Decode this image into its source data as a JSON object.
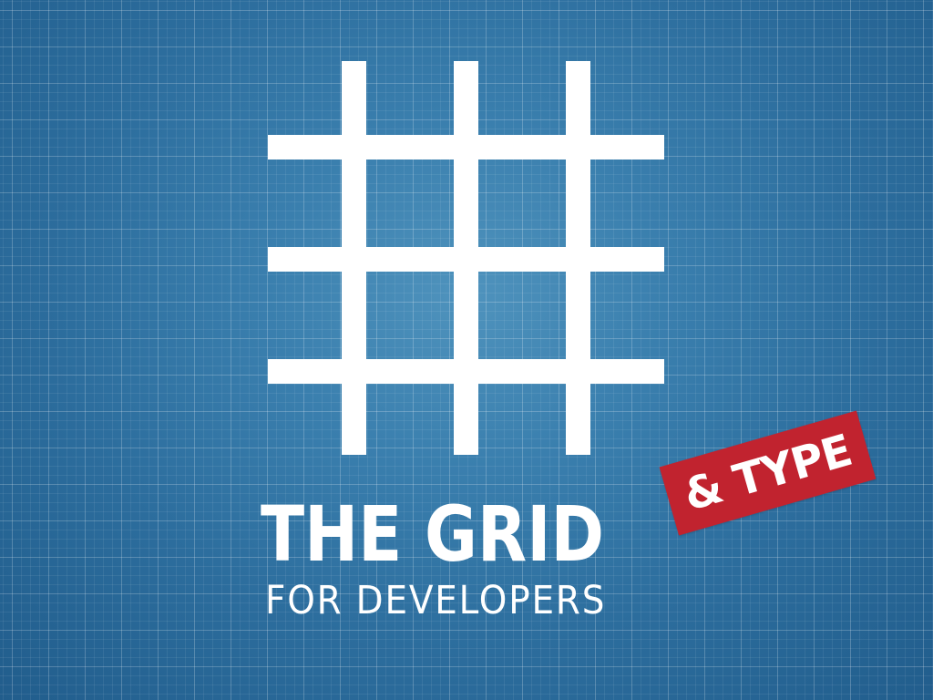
{
  "slide": {
    "title": "THE GRID",
    "subtitle": "FOR DEVELOPERS",
    "badge": "& TYPE"
  },
  "colors": {
    "background": "#2f73a3",
    "grid_lines": "#ffffff",
    "foreground": "#ffffff",
    "badge": "#c1232f"
  },
  "logo": {
    "icon": "hash-grid-icon"
  }
}
